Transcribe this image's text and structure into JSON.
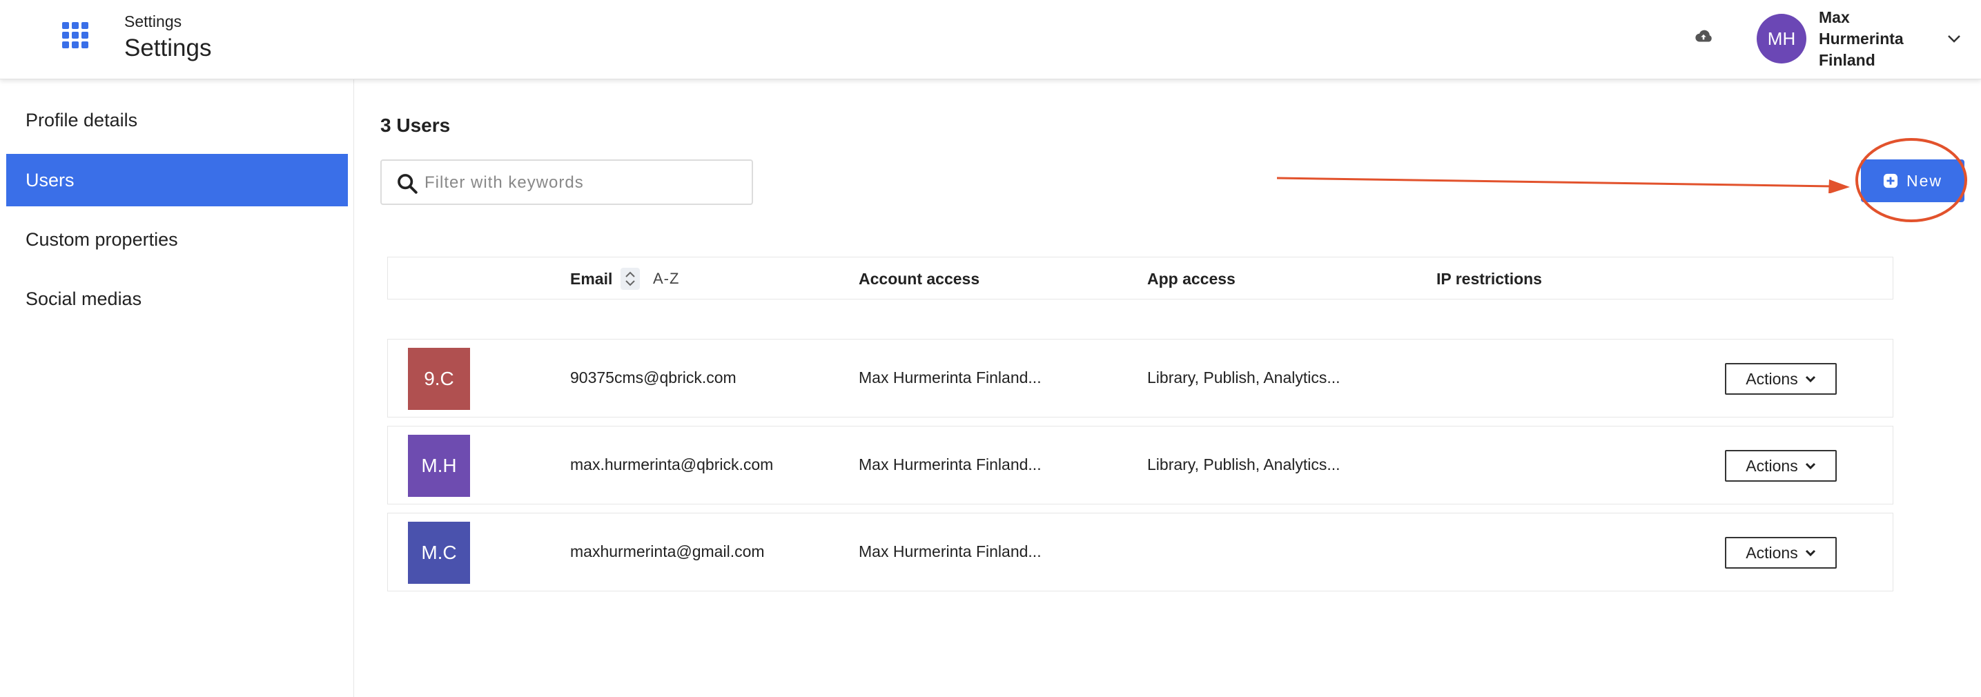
{
  "header": {
    "breadcrumb": "Settings",
    "title": "Settings",
    "user": {
      "initials": "MH",
      "name_lines": [
        "Max",
        "Hurmerinta",
        "Finland"
      ]
    }
  },
  "sidebar": {
    "items": [
      {
        "label": "Profile details",
        "active": false
      },
      {
        "label": "Users",
        "active": true
      },
      {
        "label": "Custom properties",
        "active": false
      },
      {
        "label": "Social medias",
        "active": false
      }
    ]
  },
  "main": {
    "users_count": "3 Users",
    "search": {
      "placeholder": "Filter with keywords",
      "value": ""
    },
    "new_button": "New",
    "table": {
      "headers": {
        "email": "Email",
        "sort": "A-Z",
        "account_access": "Account access",
        "app_access": "App access",
        "ip_restrictions": "IP restrictions"
      },
      "rows": [
        {
          "initials": "9.C",
          "avatar_color": "#b05050",
          "email": "90375cms@qbrick.com",
          "account_access": "Max Hurmerinta Finland...",
          "app_access": "Library, Publish, Analytics...",
          "actions": "Actions"
        },
        {
          "initials": "M.H",
          "avatar_color": "#6e4cb0",
          "email": "max.hurmerinta@qbrick.com",
          "account_access": "Max Hurmerinta Finland...",
          "app_access": "Library, Publish, Analytics...",
          "actions": "Actions"
        },
        {
          "initials": "M.C",
          "avatar_color": "#4a52ad",
          "email": "maxhurmerinta@gmail.com",
          "account_access": "Max Hurmerinta Finland...",
          "app_access": "",
          "actions": "Actions"
        }
      ]
    }
  },
  "colors": {
    "primary": "#3a6fe8",
    "annotation": "#e2522c",
    "user_avatar": "#6b47b5"
  },
  "icons": [
    "apps-grid-icon",
    "cloud-upload-icon",
    "chevron-down-icon",
    "search-icon",
    "plus-circle-icon",
    "sort-icon"
  ]
}
